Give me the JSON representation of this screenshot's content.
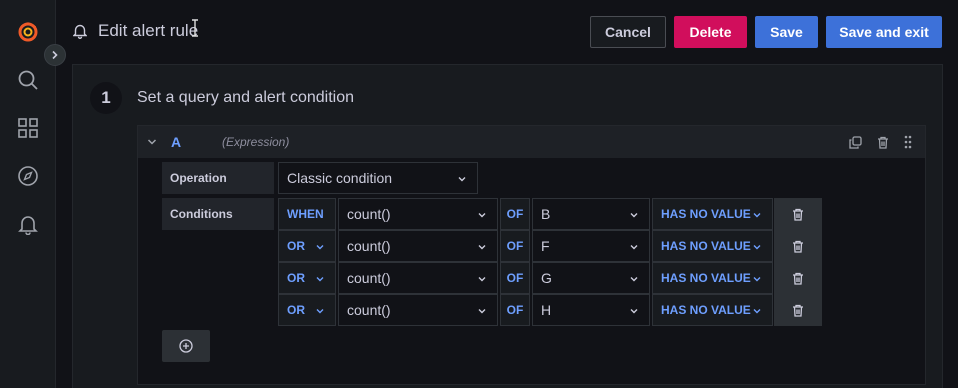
{
  "header": {
    "title": "Edit alert rule",
    "buttons": {
      "cancel": "Cancel",
      "delete": "Delete",
      "save": "Save",
      "save_exit": "Save and exit"
    }
  },
  "sidebar": {
    "items": [
      {
        "icon": "grafana-logo-icon"
      },
      {
        "icon": "search-icon"
      },
      {
        "icon": "dashboards-icon"
      },
      {
        "icon": "explore-compass-icon"
      },
      {
        "icon": "alerting-bell-icon"
      }
    ]
  },
  "step": {
    "number": "1",
    "title": "Set a query and alert condition"
  },
  "query": {
    "ref_id": "A",
    "type": "(Expression)",
    "operation_label": "Operation",
    "operation_value": "Classic condition",
    "conditions_label": "Conditions",
    "conditions": [
      {
        "op": "WHEN",
        "reducer": "count()",
        "of": "OF",
        "query": "B",
        "evaluator": "HAS NO VALUE"
      },
      {
        "op": "OR",
        "reducer": "count()",
        "of": "OF",
        "query": "F",
        "evaluator": "HAS NO VALUE"
      },
      {
        "op": "OR",
        "reducer": "count()",
        "of": "OF",
        "query": "G",
        "evaluator": "HAS NO VALUE"
      },
      {
        "op": "OR",
        "reducer": "count()",
        "of": "OF",
        "query": "H",
        "evaluator": "HAS NO VALUE"
      }
    ]
  },
  "colors": {
    "accent": "#3d71d9",
    "danger": "#d10e5c",
    "keyword": "#6e9fff",
    "logo": "#f05a28"
  }
}
